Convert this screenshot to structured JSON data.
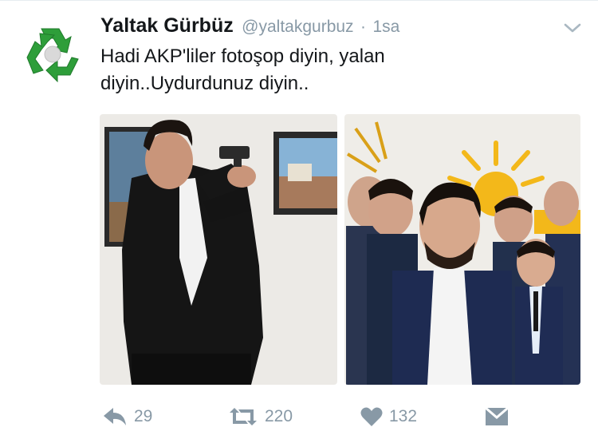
{
  "tweet": {
    "author_name": "Yaltak Gürbüz",
    "handle": "@yaltakgurbuz",
    "separator": "·",
    "time": "1sa",
    "text": "Hadi AKP'liler fotoşop diyin, yalan diyin..Uydurdunuz diyin..",
    "avatar_icon": "recycle-icon",
    "menu_icon": "chevron-down-icon"
  },
  "media": [
    {
      "alt_icon": "photo-gunman"
    },
    {
      "alt_icon": "photo-group-selfie"
    }
  ],
  "actions": {
    "reply_count": "29",
    "retweet_count": "220",
    "like_count": "132",
    "reply_icon": "reply-icon",
    "retweet_icon": "retweet-icon",
    "like_icon": "heart-icon",
    "dm_icon": "direct-message-icon"
  },
  "colors": {
    "text": "#14171a",
    "secondary": "#8899a6",
    "avatar_green": "#2e9e3a",
    "akp_yellow": "#f3b81a"
  }
}
